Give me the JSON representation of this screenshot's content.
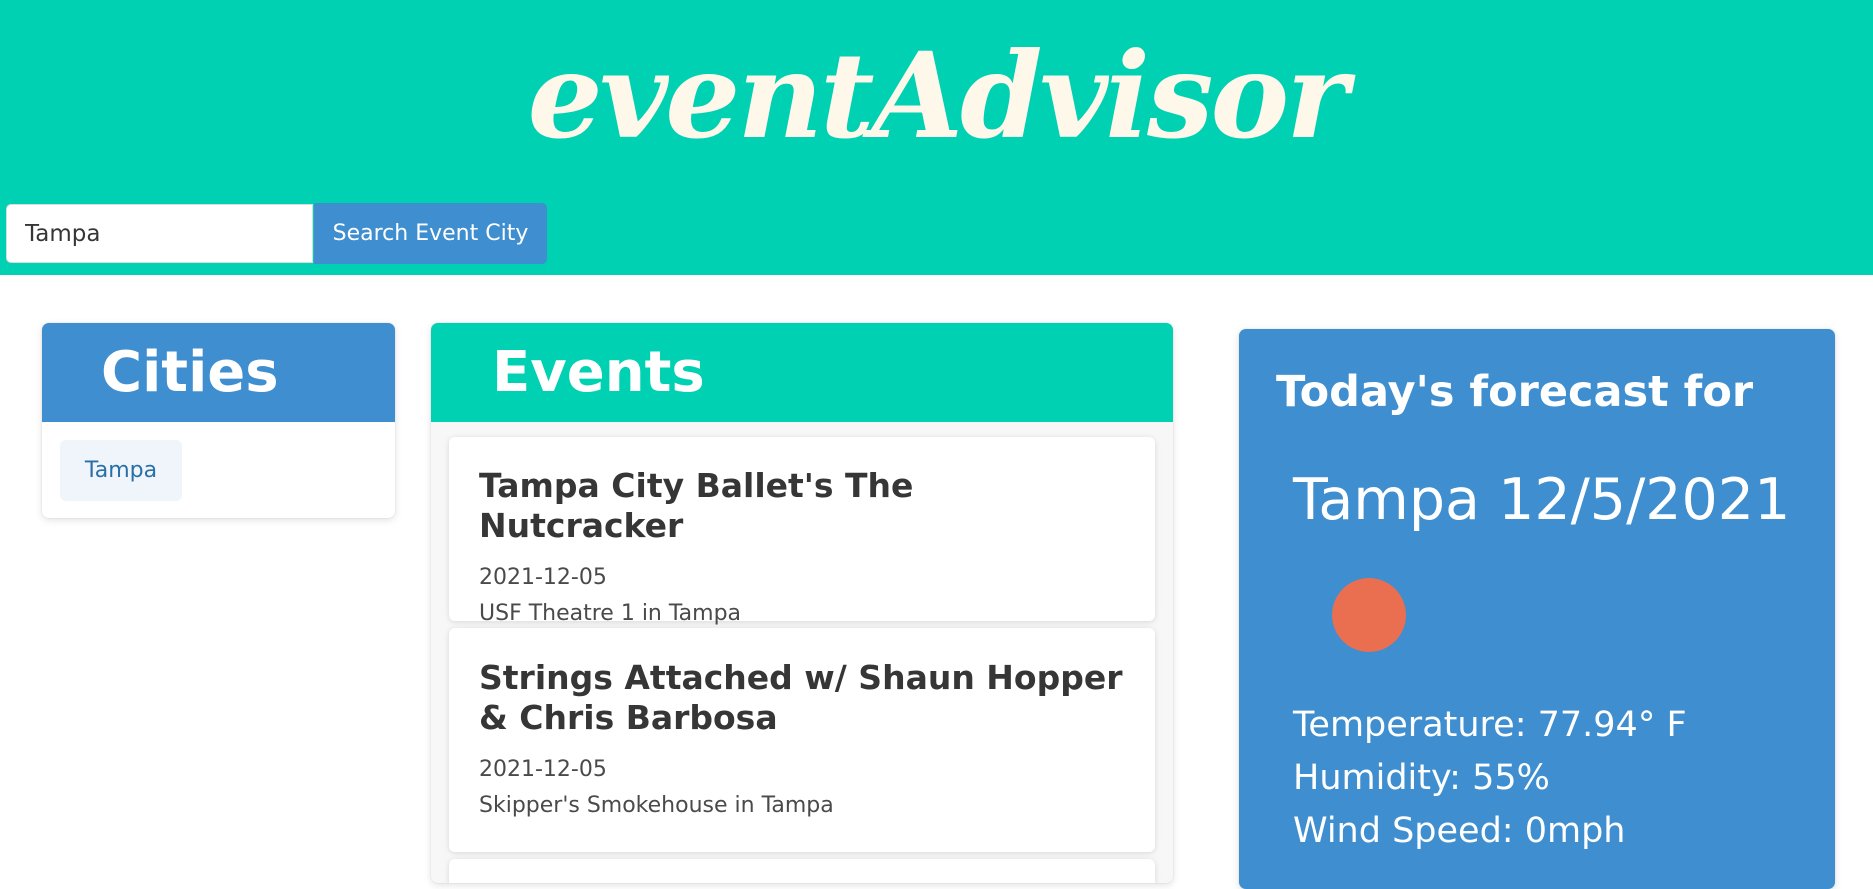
{
  "header": {
    "brand": "eventAdvisor",
    "search_value": "Tampa",
    "search_button_label": "Search Event City"
  },
  "cities": {
    "title": "Cities",
    "items": [
      {
        "label": "Tampa"
      }
    ]
  },
  "events": {
    "title": "Events",
    "items": [
      {
        "title": "Tampa City Ballet's The Nutcracker",
        "date": "2021-12-05",
        "venue": "USF Theatre 1 in Tampa"
      },
      {
        "title": "Strings Attached w/ Shaun Hopper & Chris Barbosa",
        "date": "2021-12-05",
        "venue": "Skipper's Smokehouse in Tampa"
      }
    ]
  },
  "forecast": {
    "heading": "Today's forecast for",
    "city_date": "Tampa 12/5/2021",
    "icon": "sun-icon",
    "temperature": "Temperature: 77.94° F",
    "humidity": "Humidity: 55%",
    "wind_speed": "Wind Speed: 0mph"
  },
  "colors": {
    "header_bg": "#00d1b2",
    "brand_text": "#fdf8ea",
    "primary_blue": "#3e8ed0",
    "sun": "#ea6f51"
  }
}
